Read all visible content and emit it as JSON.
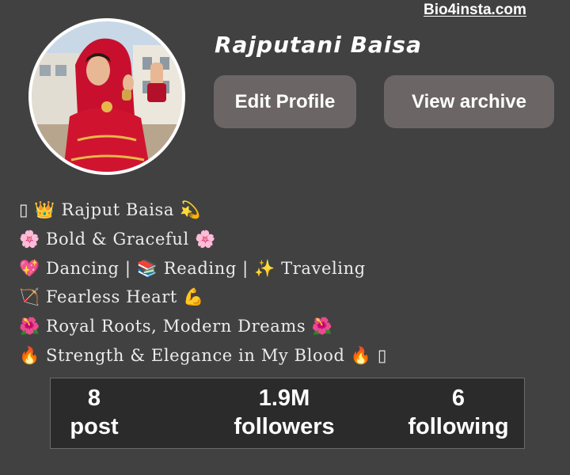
{
  "watermark": "Bio4insta.com",
  "profile": {
    "username": "Rajputani Baisa",
    "avatar_icon": "profile-photo-woman-red-saree"
  },
  "buttons": {
    "edit_profile": "Edit Profile",
    "view_archive": "View archive"
  },
  "bio": [
    "▯ 👑 Rajput Baisa 💫",
    "🌸 Bold & Graceful 🌸",
    "💖 Dancing | 📚 Reading | ✨ Traveling",
    "🏹 Fearless Heart 💪",
    "🌺 Royal Roots, Modern Dreams 🌺",
    "🔥 Strength & Elegance in My Blood 🔥 ▯"
  ],
  "stats": {
    "posts": {
      "count": "8",
      "label": "post"
    },
    "followers": {
      "count": "1.9M",
      "label": "followers"
    },
    "following": {
      "count": "6",
      "label": "following"
    }
  },
  "colors": {
    "background": "#414141",
    "button": "#6b6565",
    "stats_panel": "#2b2b2b"
  }
}
